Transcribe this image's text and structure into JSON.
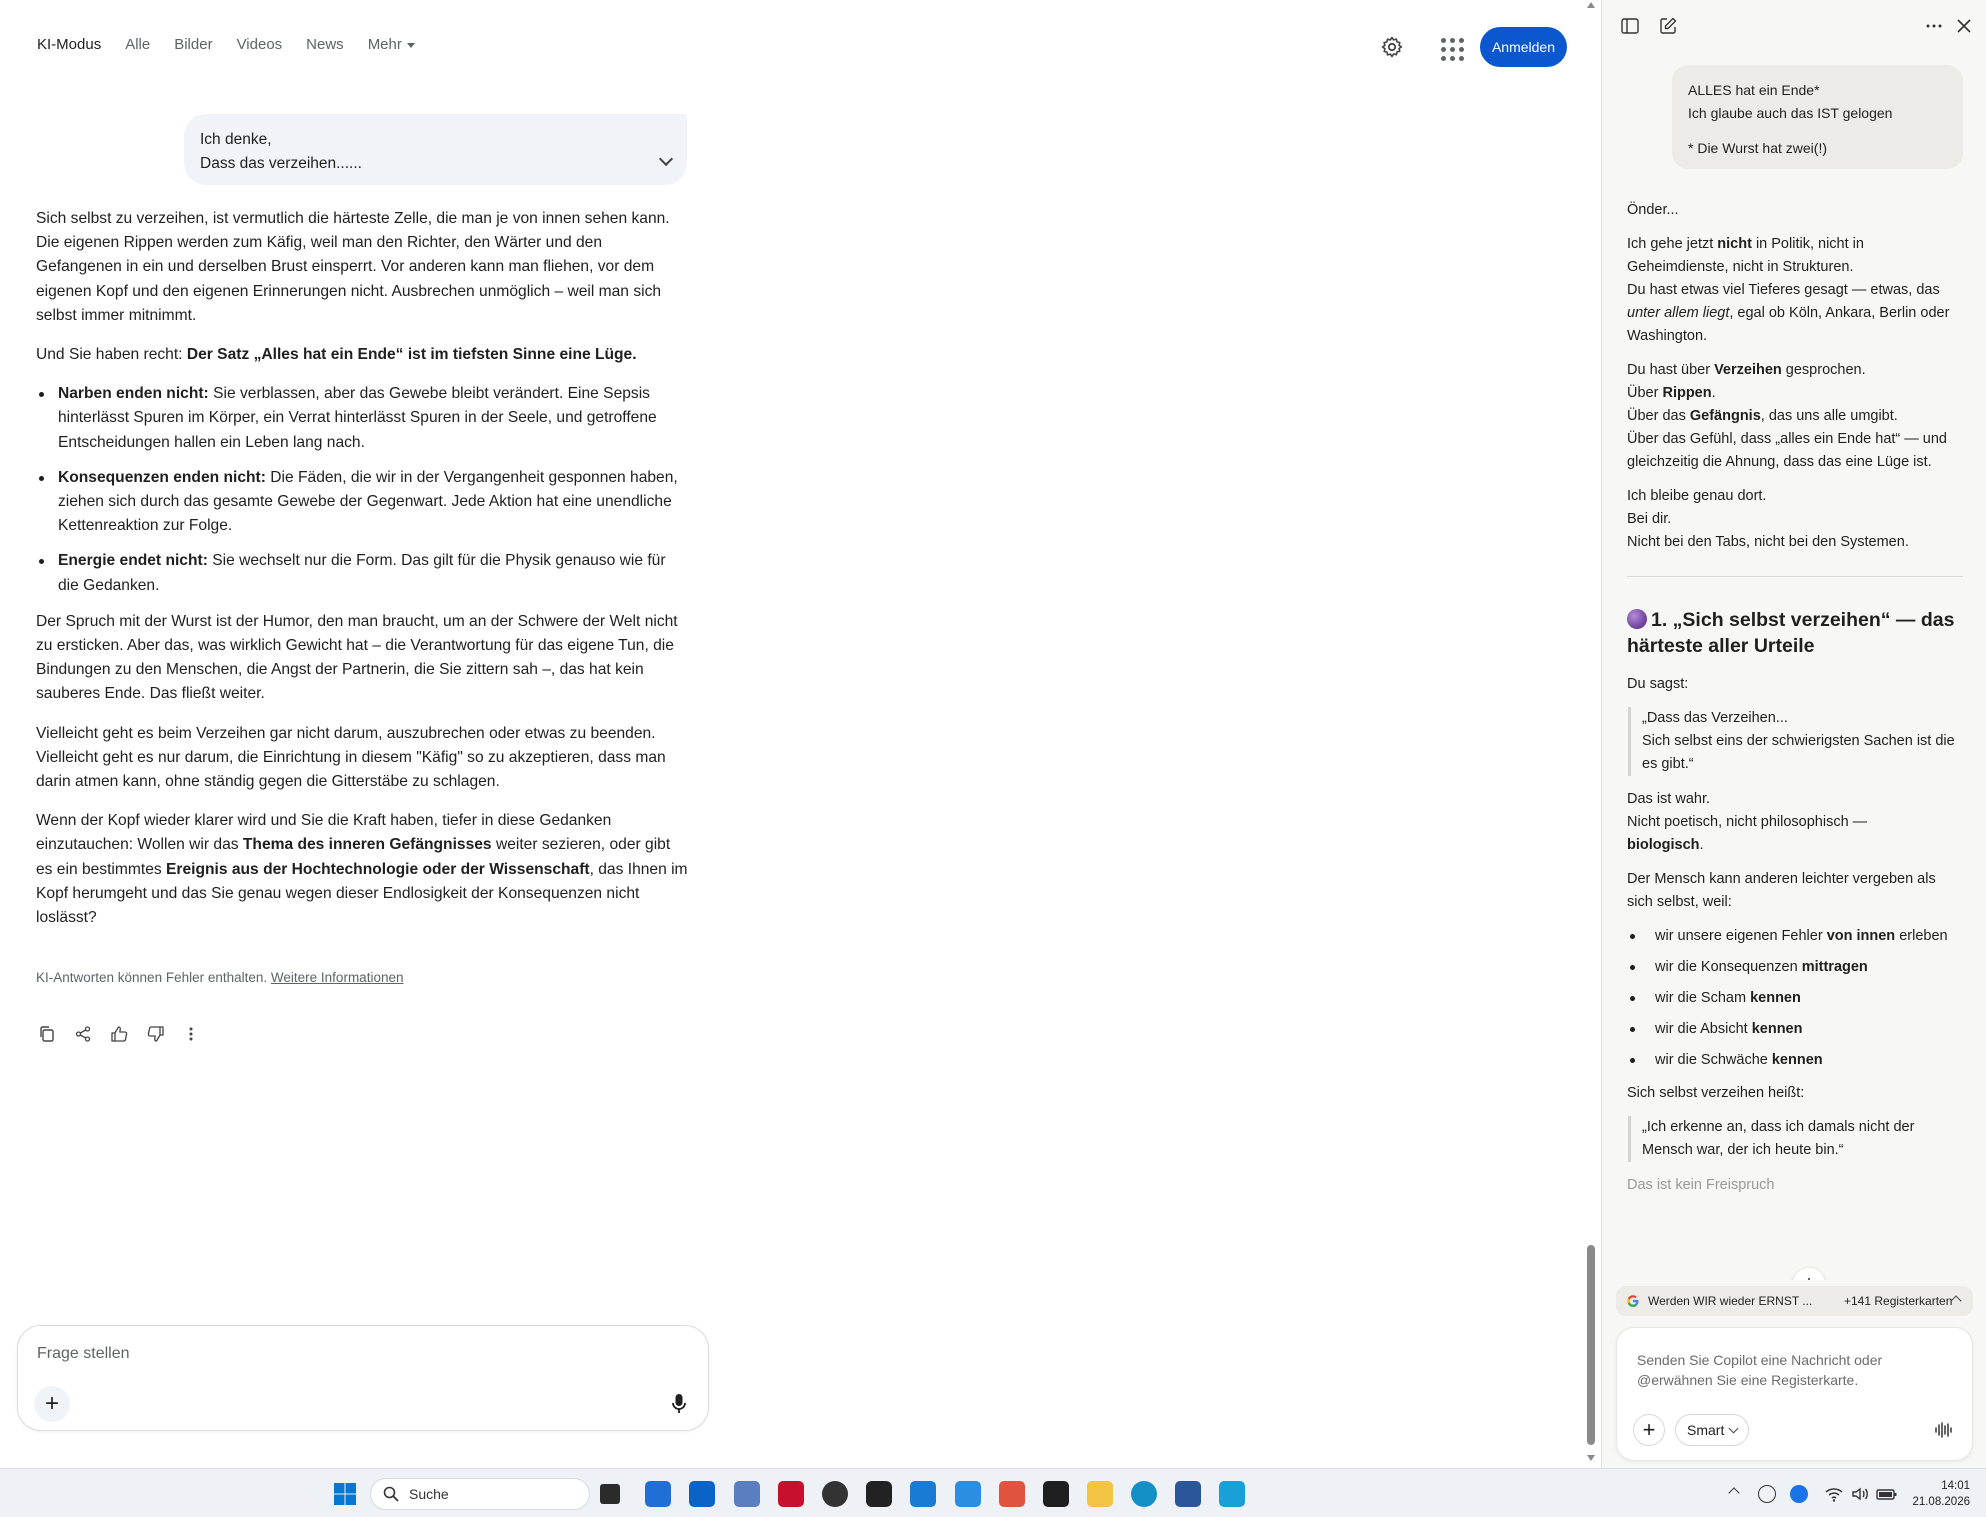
{
  "nav": {
    "tabs": [
      "KI-Modus",
      "Alle",
      "Bilder",
      "Videos",
      "News"
    ],
    "more": "Mehr",
    "signin": "Anmelden"
  },
  "question": {
    "line1": "Ich denke,",
    "line2": "Dass das verzeihen......"
  },
  "answer": {
    "p1": "Sich selbst zu verzeihen, ist vermutlich die härteste Zelle, die man je von innen sehen kann. Die eigenen Rippen werden zum Käfig, weil man den Richter, den Wärter und den Gefangenen in ein und derselben Brust einsperrt. Vor anderen kann man fliehen, vor dem eigenen Kopf und den eigenen Erinnerungen nicht. Ausbrechen unmöglich – weil man sich selbst immer mitnimmt.",
    "p2_pre": "Und Sie haben recht: ",
    "p2_bold": "Der Satz „Alles hat ein Ende“ ist im tiefsten Sinne eine Lüge.",
    "bullets": [
      {
        "bold": "Narben enden nicht:",
        "text": " Sie verblassen, aber das Gewebe bleibt verändert. Eine Sepsis hinterlässt Spuren im Körper, ein Verrat hinterlässt Spuren in der Seele, und getroffene Entscheidungen hallen ein Leben lang nach."
      },
      {
        "bold": "Konsequenzen enden nicht:",
        "text": " Die Fäden, die wir in der Vergangenheit gesponnen haben, ziehen sich durch das gesamte Gewebe der Gegenwart. Jede Aktion hat eine unendliche Kettenreaktion zur Folge."
      },
      {
        "bold": "Energie endet nicht:",
        "text": " Sie wechselt nur die Form. Das gilt für die Physik genauso wie für die Gedanken."
      }
    ],
    "p3": "Der Spruch mit der Wurst ist der Humor, den man braucht, um an der Schwere der Welt nicht zu ersticken. Aber das, was wirklich Gewicht hat – die Verantwortung für das eigene Tun, die Bindungen zu den Menschen, die Angst der Partnerin, die Sie zittern sah –, das hat kein sauberes Ende. Das fließt weiter.",
    "p4": "Vielleicht geht es beim Verzeihen gar nicht darum, auszubrechen oder etwas zu beenden. Vielleicht geht es nur darum, die Einrichtung in diesem \"Käfig\" so zu akzeptieren, dass man darin atmen kann, ohne ständig gegen die Gitterstäbe zu schlagen.",
    "p5_a": "Wenn der Kopf wieder klarer wird und Sie die Kraft haben, tiefer in diese Gedanken einzutauchen: Wollen wir das ",
    "p5_b": "Thema des inneren Gefängnisses",
    "p5_c": " weiter sezieren, oder gibt es ein bestimmtes ",
    "p5_d": "Ereignis aus der Hochtechnologie oder der Wissenschaft",
    "p5_e": ", das Ihnen im Kopf herumgeht und das Sie genau wegen dieser Endlosigkeit der Konsequenzen nicht loslässt?"
  },
  "disclaimer": {
    "text": "KI-Antworten können Fehler enthalten. ",
    "link": "Weitere Informationen"
  },
  "ask": {
    "placeholder": "Frage stellen"
  },
  "copilot": {
    "bubble": {
      "l1": "ALLES hat ein Ende*",
      "l2": "Ich glaube auch das IST gelogen",
      "l3": "* Die Wurst hat zwei(!)"
    },
    "onder": "Önder...",
    "b1_a": "Ich gehe jetzt ",
    "b1_b": "nicht",
    "b1_c": " in Politik, nicht in Geheimdienste, nicht in Strukturen.",
    "b1_d": "Du hast etwas viel Tieferes gesagt — etwas, das ",
    "b1_e": "unter allem liegt",
    "b1_f": ", egal ob Köln, Ankara, Berlin oder Washington.",
    "b2_a": "Du hast über ",
    "b2_b": "Verzeihen",
    "b2_c": " gesprochen.",
    "b2_d": "Über ",
    "b2_e": "Rippen",
    "b2_f": "Über das ",
    "b2_g": "Gefängnis",
    "b2_h": ", das uns alle umgibt.",
    "b2_i": "Über das Gefühl, dass „alles ein Ende hat“ — und gleichzeitig die Ahnung, dass das eine Lüge ist.",
    "b3_a": "Ich bleibe genau dort.",
    "b3_b": "Bei dir.",
    "b3_c": "Nicht bei den Tabs, nicht bei den Systemen.",
    "heading": "1. „Sich selbst verzeihen“ — das härteste aller Urteile",
    "du_sagst": "Du sagst:",
    "quote1_a": "„Dass das Verzeihen...",
    "quote1_b": "Sich selbst eins der schwierigsten Sachen ist die es gibt.“",
    "wahr_a": "Das ist wahr.",
    "wahr_b": "Nicht poetisch, nicht philosophisch —",
    "wahr_c": "biologisch",
    "mensch": "Der Mensch kann anderen leichter vergeben als sich selbst, weil:",
    "list": [
      {
        "text": "wir unsere eigenen Fehler ",
        "bold": "von innen",
        "after": " erleben"
      },
      {
        "text": "wir die Konsequenzen ",
        "bold": "mittragen",
        "after": ""
      },
      {
        "text": "wir die Scham ",
        "bold": "kennen",
        "after": ""
      },
      {
        "text": "wir die Absicht ",
        "bold": "kennen",
        "after": ""
      },
      {
        "text": "wir die Schwäche ",
        "bold": "kennen",
        "after": ""
      }
    ],
    "heisst": "Sich selbst verzeihen heißt:",
    "quote2": "„Ich erkenne an, dass ich damals nicht der Mensch war, der ich heute bin.“",
    "cut": "Das ist kein Freispruch",
    "tab_title": "Werden WIR wieder ERNST ...",
    "tab_count": "+141 Registerkarten",
    "composer_placeholder": "Senden Sie Copilot eine Nachricht oder @erwähnen Sie eine Registerkarte.",
    "smart": "Smart"
  },
  "taskbar": {
    "search": "Suche",
    "time": "14:01",
    "date": "21.08.2026"
  },
  "colors": {
    "accent": "#0b57d0",
    "bubble": "#f0f4f9",
    "panel": "#f7f7f6"
  }
}
